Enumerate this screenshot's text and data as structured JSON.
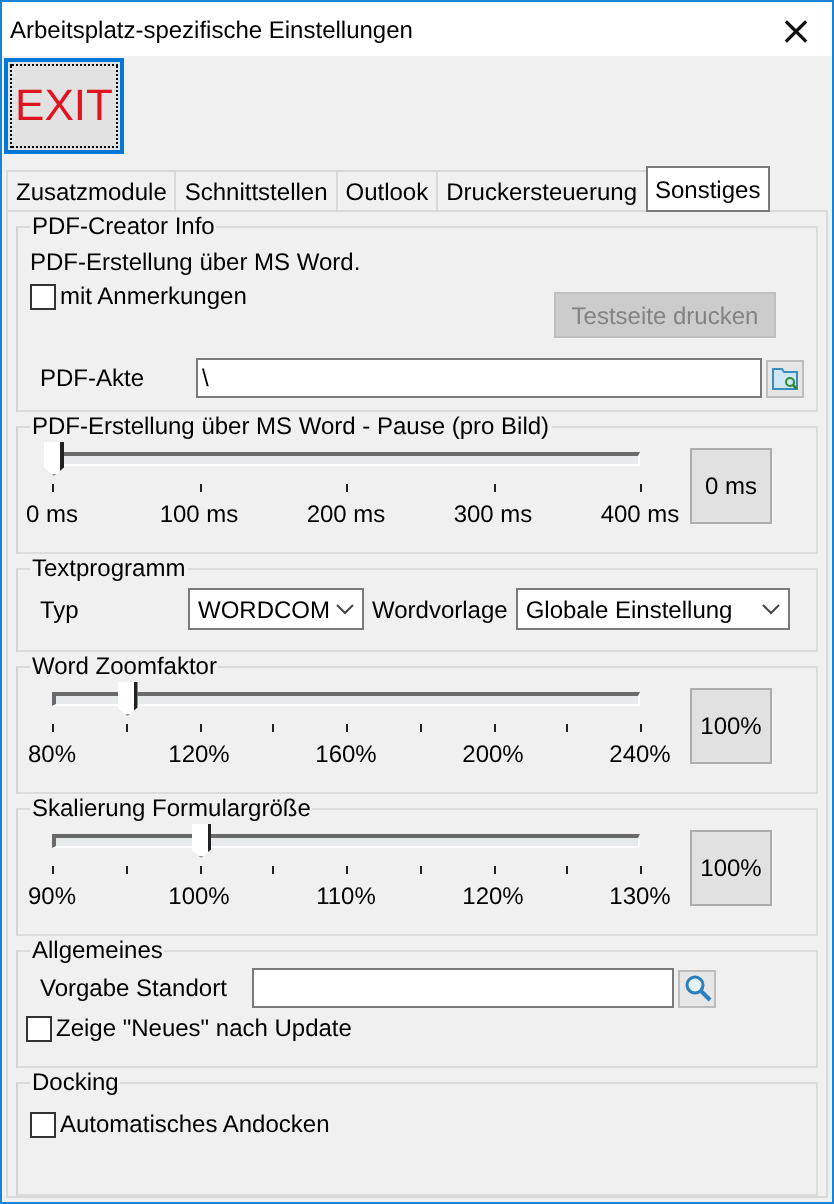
{
  "window": {
    "title": "Arbeitsplatz-spezifische Einstellungen",
    "close": "×"
  },
  "toolbar": {
    "exit_button": "EXIT"
  },
  "tabs": [
    {
      "label": "Zusatzmodule",
      "selected": false
    },
    {
      "label": "Schnittstellen",
      "selected": false
    },
    {
      "label": "Outlook",
      "selected": false
    },
    {
      "label": "Druckersteuerung",
      "selected": false
    },
    {
      "label": "Sonstiges",
      "selected": true
    }
  ],
  "pdf_creator": {
    "title": "PDF-Creator Info",
    "info": "PDF-Erstellung über MS Word.",
    "annotations": {
      "label": "mit Anmerkungen",
      "checked": false
    },
    "test_button": {
      "label": "Testseite drucken",
      "disabled": true
    },
    "file_label": "PDF-Akte",
    "file_value": "\\"
  },
  "sliders": [
    {
      "title": "PDF-Erstellung über MS Word - Pause (pro Bild)",
      "level": 0,
      "minor_ticks": false,
      "labels": [
        "0 ms",
        "100 ms",
        "200 ms",
        "300 ms",
        "400 ms"
      ],
      "value": "0 ms"
    },
    {
      "title": "Word Zoomfaktor",
      "level": 0.125,
      "minor_ticks": true,
      "labels": [
        "80%",
        "120%",
        "160%",
        "200%",
        "240%"
      ],
      "value": "100%"
    },
    {
      "title": "Skalierung Formulargröße",
      "level": 0.25,
      "minor_ticks": true,
      "labels": [
        "90%",
        "100%",
        "110%",
        "120%",
        "130%"
      ],
      "value": "100%"
    }
  ],
  "text_program": {
    "title": "Textprogramm",
    "type_label": "Typ",
    "type_value": "WORDCOM",
    "template_label": "Wordvorlage",
    "template_value": "Globale Einstellung"
  },
  "general": {
    "title": "Allgemeines",
    "location_label": "Vorgabe Standort",
    "show_news": {
      "label": "Zeige \"Neues\" nach Update",
      "checked": false
    }
  },
  "docking": {
    "title": "Docking",
    "auto_dock": {
      "label": "Automatisches Andocken",
      "checked": false
    }
  }
}
